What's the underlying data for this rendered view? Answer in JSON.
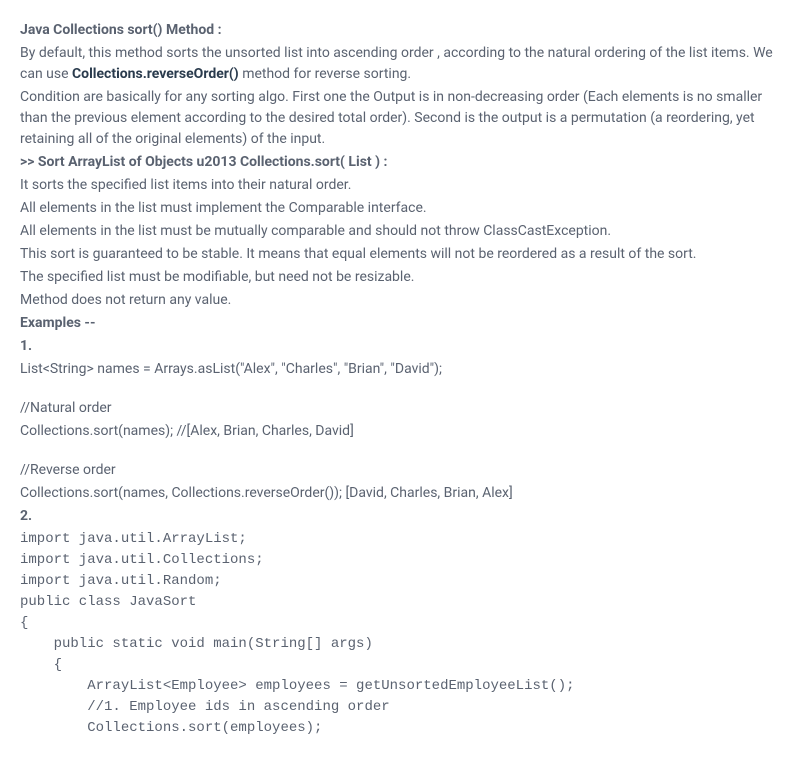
{
  "title": "Java Collections sort() Method :",
  "para_intro_a": "By default, this method sorts the unsorted list into ascending order , according to the natural ordering of the list items. We can use ",
  "para_intro_bold": "Collections.reverseOrder()",
  "para_intro_b": " method for reverse sorting.",
  "para_cond": "Condition are basically for any sorting algo. First one the Output is in non-decreasing order (Each elements is no smaller than the previous element according to the desired total order). Second is the output is a permutation (a reordering, yet retaining all of the original elements) of the input.",
  "subtitle": ">> Sort ArrayList of Objects u2013 Collections.sort( List ) :",
  "bullets": [
    "It sorts the specified list items into their natural order.",
    "All elements in the list must implement the Comparable interface.",
    "All elements in the list must be mutually comparable and should not throw ClassCastException.",
    "This sort is guaranteed to be stable. It means that equal elements will not be reordered as a result of the sort.",
    "The specified list must be modifiable, but need not be resizable.",
    "Method does not return any value."
  ],
  "examples_label": "Examples --",
  "ex1_label": "1.",
  "ex1_line1": "List<String> names = Arrays.asList(\"Alex\", \"Charles\", \"Brian\", \"David\");",
  "ex1_nat_comment": "//Natural order",
  "ex1_nat_code": "Collections.sort(names); //[Alex, Brian, Charles, David]",
  "ex1_rev_comment": "//Reverse order",
  "ex1_rev_code": "Collections.sort(names, Collections.reverseOrder()); [David, Charles, Brian, Alex]",
  "ex2_label": "2.",
  "code_lines": [
    "import java.util.ArrayList;",
    "import java.util.Collections;",
    "import java.util.Random;",
    "public class JavaSort",
    "{",
    "    public static void main(String[] args)",
    "    {",
    "        ArrayList<Employee> employees = getUnsortedEmployeeList();",
    "",
    "        //1. Employee ids in ascending order",
    "        Collections.sort(employees);"
  ]
}
